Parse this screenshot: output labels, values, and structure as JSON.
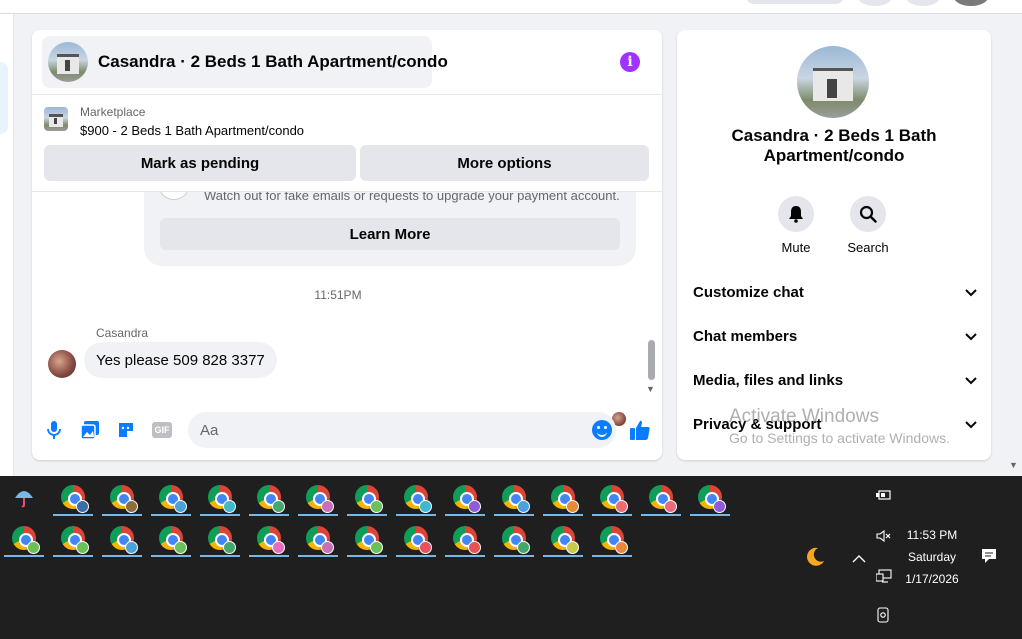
{
  "chat": {
    "title": "Casandra · 2 Beds 1 Bath Apartment/condo",
    "marketplace_label": "Marketplace",
    "listing": "$900 - 2 Beds 1 Bath Apartment/condo",
    "mark_pending_label": "Mark as pending",
    "more_options_label": "More options",
    "warning_text": "Watch out for fake emails or requests to upgrade your payment account.",
    "learn_more_label": "Learn More",
    "timestamp": "11:51PM",
    "sender_name": "Casandra",
    "message": "Yes please 509 828 3377",
    "composer_placeholder": "Aa"
  },
  "info_panel": {
    "title": "Casandra · 2 Beds 1 Bath Apartment/condo",
    "actions": [
      {
        "label": "Mute",
        "icon": "bell-icon"
      },
      {
        "label": "Search",
        "icon": "search-icon"
      }
    ],
    "sections": [
      {
        "label": "Customize chat"
      },
      {
        "label": "Chat members"
      },
      {
        "label": "Media, files and links"
      },
      {
        "label": "Privacy & support"
      }
    ]
  },
  "watermark": {
    "line1": "Activate Windows",
    "line2": "Go to Settings to activate Windows."
  },
  "taskbar": {
    "time": "11:53 PM",
    "day": "Saturday",
    "date": "1/17/2026",
    "row1_badges": [
      "#3b6ea5",
      "#8a6f3c",
      "#4aa3d8",
      "#3fb8c9",
      "#42a86b",
      "#c96fb8",
      "#6ac15a",
      "#3fb8c9",
      "#8f5bd6",
      "#4aa3d8",
      "#e8893a",
      "#e86c7a",
      "#e86c7a",
      "#8f5bd6"
    ],
    "row2_badges": [
      "#6ac15a",
      "#6ac15a",
      "#4aa3d8",
      "#6ac15a",
      "#42a86b",
      "#e86cc0",
      "#c96fb8",
      "#6ac15a",
      "#e8505b",
      "#e8505b",
      "#42a86b",
      "#c9c94a",
      "#e8893a"
    ]
  }
}
